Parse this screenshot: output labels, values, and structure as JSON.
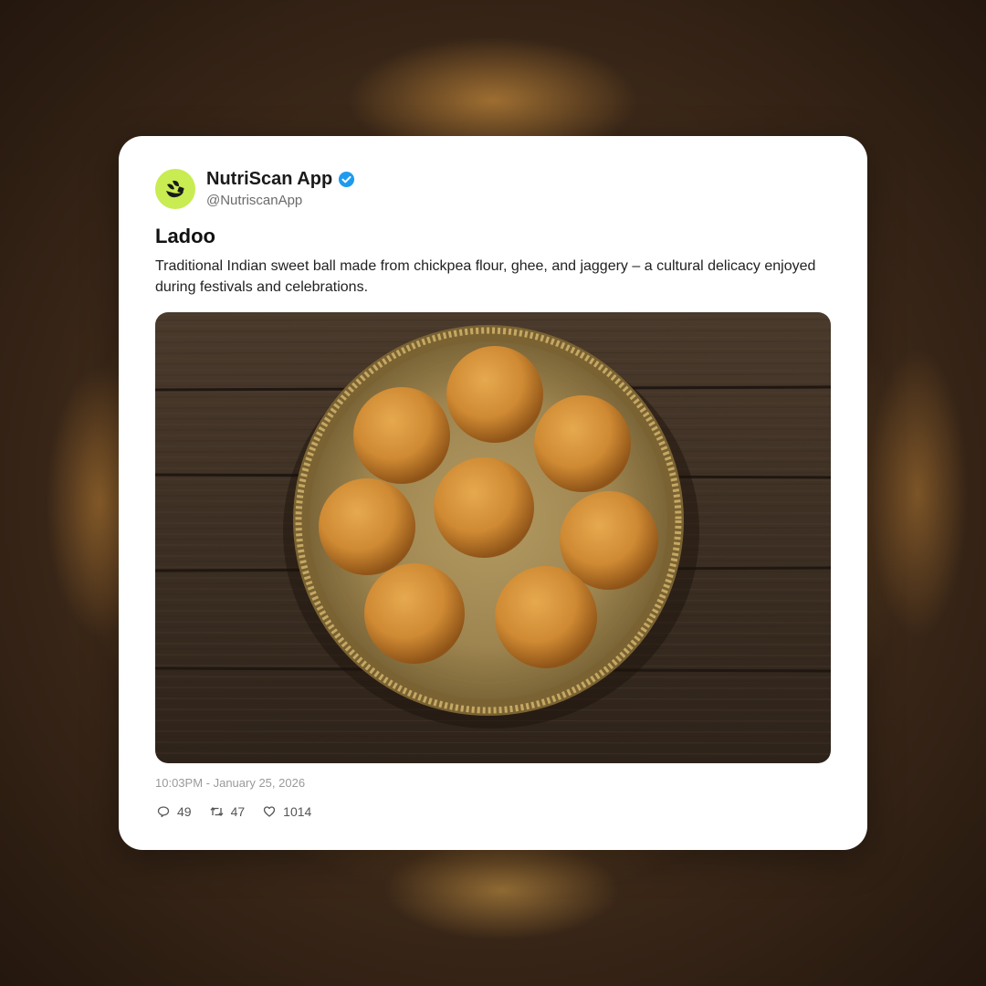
{
  "account": {
    "name": "NutriScan App",
    "handle": "@NutriscanApp",
    "avatar_color": "#c8ec52",
    "verified_color": "#1d9bf0",
    "verified_icon": "verified-badge-icon"
  },
  "post": {
    "title": "Ladoo",
    "description": "Traditional Indian sweet ball made from chickpea flour, ghee, and jaggery – a cultural delicacy enjoyed during festivals and celebrations.",
    "image_subject": "brass plate with eight ladoos on a wooden table",
    "timestamp": "10:03PM - January 25, 2026"
  },
  "stats": {
    "replies": "49",
    "retweets": "47",
    "likes": "1014"
  }
}
